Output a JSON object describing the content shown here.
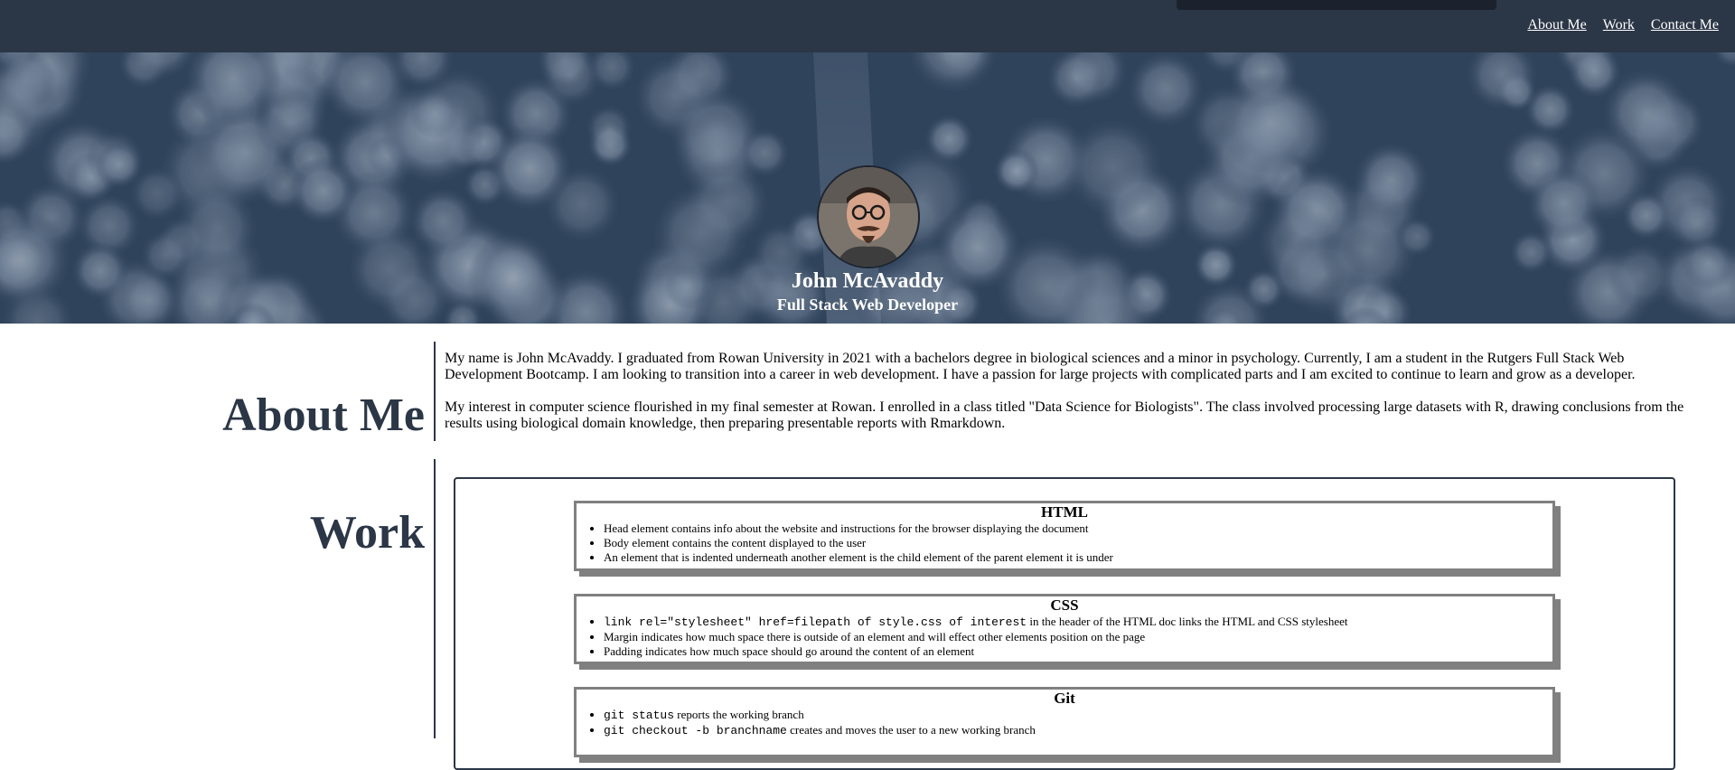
{
  "nav": {
    "items": [
      "About Me",
      "Work",
      "Contact Me"
    ]
  },
  "hero": {
    "name": "John McAvaddy",
    "role": "Full Stack Web Developer"
  },
  "about": {
    "heading": "About Me",
    "paragraphs": [
      "My name is John McAvaddy. I graduated from Rowan University in 2021 with a bachelors degree in biological sciences and a minor in psychology. Currently, I am a student in the Rutgers Full Stack Web Development Bootcamp. I am looking to transition into a career in web development. I have a passion for large projects with complicated parts and I am excited to continue to learn and grow as a developer.",
      "My interest in computer science flourished in my final semester at Rowan. I enrolled in a class titled \"Data Science for Biologists\". The class involved processing large datasets with R, drawing conclusions from the results using biological domain knowledge, then preparing presentable reports with Rmarkdown."
    ]
  },
  "work": {
    "heading": "Work",
    "cards": [
      {
        "title": "HTML",
        "items": [
          {
            "code": "",
            "text": "Head element contains info about the website and instructions for the browser displaying the document"
          },
          {
            "code": "",
            "text": "Body element contains the content displayed to the user"
          },
          {
            "code": "",
            "text": "An element that is indented underneath another element is the child element of the parent element it is under"
          }
        ]
      },
      {
        "title": "CSS",
        "items": [
          {
            "code": "link rel=\"stylesheet\" href=filepath of style.css of interest",
            "text": " in the header of the HTML doc links the HTML and CSS stylesheet"
          },
          {
            "code": "",
            "text": "Margin indicates how much space there is outside of an element and will effect other elements position on the page"
          },
          {
            "code": "",
            "text": "Padding indicates how much space should go around the content of an element"
          }
        ]
      },
      {
        "title": "Git",
        "items": [
          {
            "code": "git status",
            "text": " reports the working branch"
          },
          {
            "code": "git checkout -b branchname",
            "text": " creates and moves the user to a new working branch"
          }
        ]
      }
    ]
  },
  "colors": {
    "header_bg": "#2b3646",
    "accent": "#2b3646",
    "card_border": "#808080"
  }
}
